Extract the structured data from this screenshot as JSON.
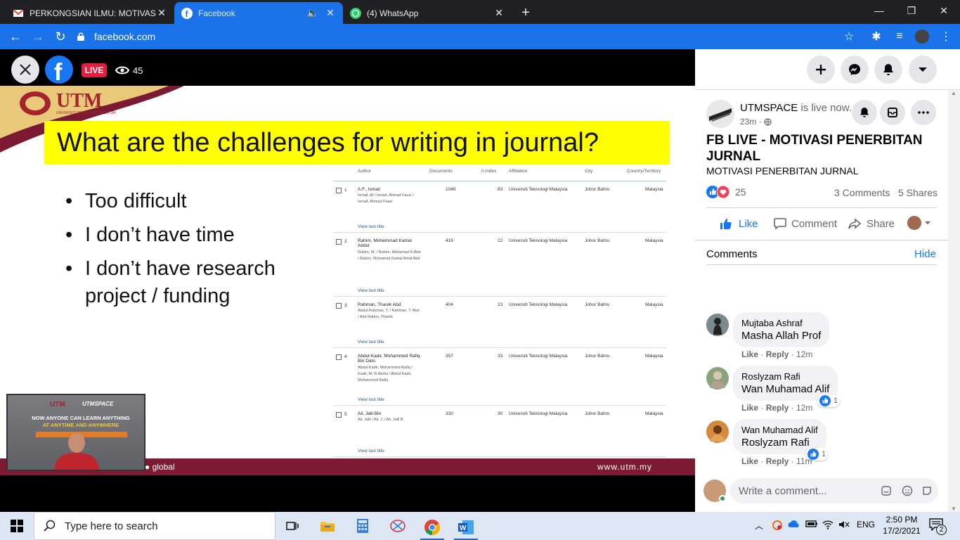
{
  "browser": {
    "tabs": [
      {
        "title": "PERKONGSIAN ILMU: MOTIVASI P",
        "icon": "gmail-icon"
      },
      {
        "title": "Facebook",
        "icon": "facebook-icon"
      },
      {
        "title": "(4) WhatsApp",
        "icon": "whatsapp-icon"
      }
    ],
    "new_tab": "+",
    "url": "facebook.com"
  },
  "video": {
    "live_label": "LIVE",
    "viewer_count": "45",
    "slide": {
      "logo_text": "UTM",
      "logo_sub": "UNIVERSITI TEKNOLOGI MALAYSIA",
      "question": "What are the challenges for writing in journal?",
      "bullets": [
        "Too difficult",
        "I don’t have time",
        "I don’t have research",
        "project / funding"
      ],
      "band_left": "● global",
      "band_right": "www.utm.my",
      "table": {
        "headers": [
          "Author",
          "Documents",
          "h-index",
          "Affiliation",
          "City",
          "Country/Territory"
        ],
        "rows": [
          {
            "num": "1",
            "author": "A.F., Ismail",
            "aliases": "Ismail, Af / Ismail, Ahmad Fauzi / Ismail, Ahmad Fuazi",
            "docs": "1049",
            "h": "83",
            "aff": "Universiti Teknologi Malaysia",
            "city": "Johor Bahru",
            "country": "Malaysia"
          },
          {
            "num": "2",
            "author": "Rahim, Mohammad Kamal Abdul",
            "aliases": "Rahim, M. / Rahim, Mohamad K.Abd / Rahim, Mohamad Kamal Amal Abd",
            "docs": "416",
            "h": "22",
            "aff": "Universiti Teknologi Malaysia",
            "city": "Johor Bahru",
            "country": "Malaysia"
          },
          {
            "num": "3",
            "author": "Rahman, Tharek Abd",
            "aliases": "Abdul-Rahman, T. / Rahman, T. Abd / Abd Rahim, Tharek",
            "docs": "404",
            "h": "23",
            "aff": "Universiti Teknologi Malaysia",
            "city": "Johor Bahru",
            "country": "Malaysia"
          },
          {
            "num": "4",
            "author": "Abdul-Kadir, Mohammed Rafiq Bin Dato",
            "aliases": "Abdul-Kadir, Mohammed Rafiq / Kadir, M. R.Abdul / Abdul Kadir, Mohammed Rafiq",
            "docs": "357",
            "h": "33",
            "aff": "Universiti Teknologi Malaysia",
            "city": "Johor Bahru",
            "country": "Malaysia"
          },
          {
            "num": "5",
            "author": "Ali, Jalil Bin",
            "aliases": "Ali, Jalil / Ali, J. / Ali, Jalil B.",
            "docs": "330",
            "h": "30",
            "aff": "Universiti Teknologi Malaysia",
            "city": "Johor Bahru",
            "country": "Malaysia"
          }
        ],
        "view_last": "View last title"
      }
    },
    "pip": {
      "brand": "UTM",
      "brand2": "UTMSPACE",
      "tagline1": "NOW ANYONE CAN LEARN ANYTHING",
      "tagline2": "AT ANYTIME AND ANYWHERE"
    }
  },
  "post": {
    "page_name": "UTMSPACE",
    "status": "is live now.",
    "time": "23m ·",
    "title": "FB LIVE - MOTIVASI PENERBITAN JURNAL",
    "subtitle": "MOTIVASI PENERBITAN JURNAL",
    "reaction_count": "25",
    "comments_count": "3 Comments",
    "shares_count": "5 Shares",
    "actions": {
      "like": "Like",
      "comment": "Comment",
      "share": "Share"
    }
  },
  "comments": {
    "header": "Comments",
    "hide": "Hide",
    "items": [
      {
        "name": "Mujtaba Ashraf",
        "text": "Masha Allah Prof",
        "like": "Like",
        "reply": "Reply",
        "time": "12m",
        "reactions": ""
      },
      {
        "name": "Roslyzam Rafi",
        "text": "Wan Muhamad Alif",
        "like": "Like",
        "reply": "Reply",
        "time": "12m",
        "reactions": "1"
      },
      {
        "name": "Wan Muhamad Alif",
        "text": "Roslyzam Rafi",
        "like": "Like",
        "reply": "Reply",
        "time": "11m",
        "reactions": "1"
      }
    ],
    "input_placeholder": "Write a comment..."
  },
  "taskbar": {
    "search_placeholder": "Type here to search",
    "lang": "ENG",
    "time": "2:50 PM",
    "date": "17/2/2021",
    "notif_count": "2"
  },
  "colors": {
    "fb_blue": "#1877f2",
    "live_red": "#e41e3f",
    "slide_yellow": "#ffff00",
    "utm_maroon": "#7d1a33"
  }
}
